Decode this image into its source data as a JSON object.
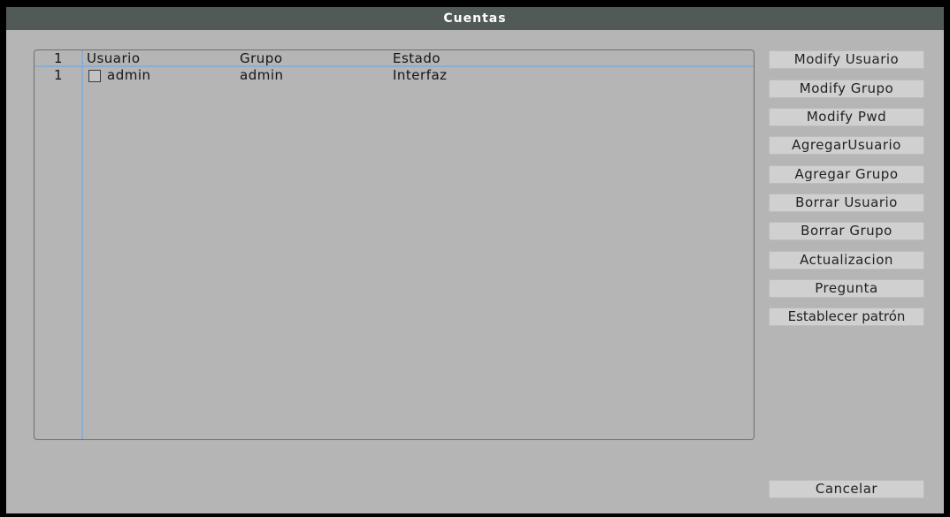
{
  "window": {
    "title": "Cuentas"
  },
  "table": {
    "headers": {
      "index": "1",
      "user": "Usuario",
      "group": "Grupo",
      "status": "Estado"
    },
    "rows": [
      {
        "index": "1",
        "user": "admin",
        "group": "admin",
        "status": "Interfaz",
        "checked": false
      }
    ]
  },
  "buttons": {
    "modify_user": "Modify Usuario",
    "modify_group": "Modify Grupo",
    "modify_pwd": "Modify Pwd",
    "add_user": "AgregarUsuario",
    "add_group": "Agregar Grupo",
    "delete_user": "Borrar Usuario",
    "delete_group": "Borrar Grupo",
    "update": "Actualizacion",
    "question": "Pregunta",
    "set_pattern": "Establecer patrón",
    "cancel": "Cancelar"
  },
  "colors": {
    "background": "#b5b5b5",
    "titlebar": "#515a56",
    "grid_lines": "#8aaed0",
    "button": "#d0d0d0"
  }
}
